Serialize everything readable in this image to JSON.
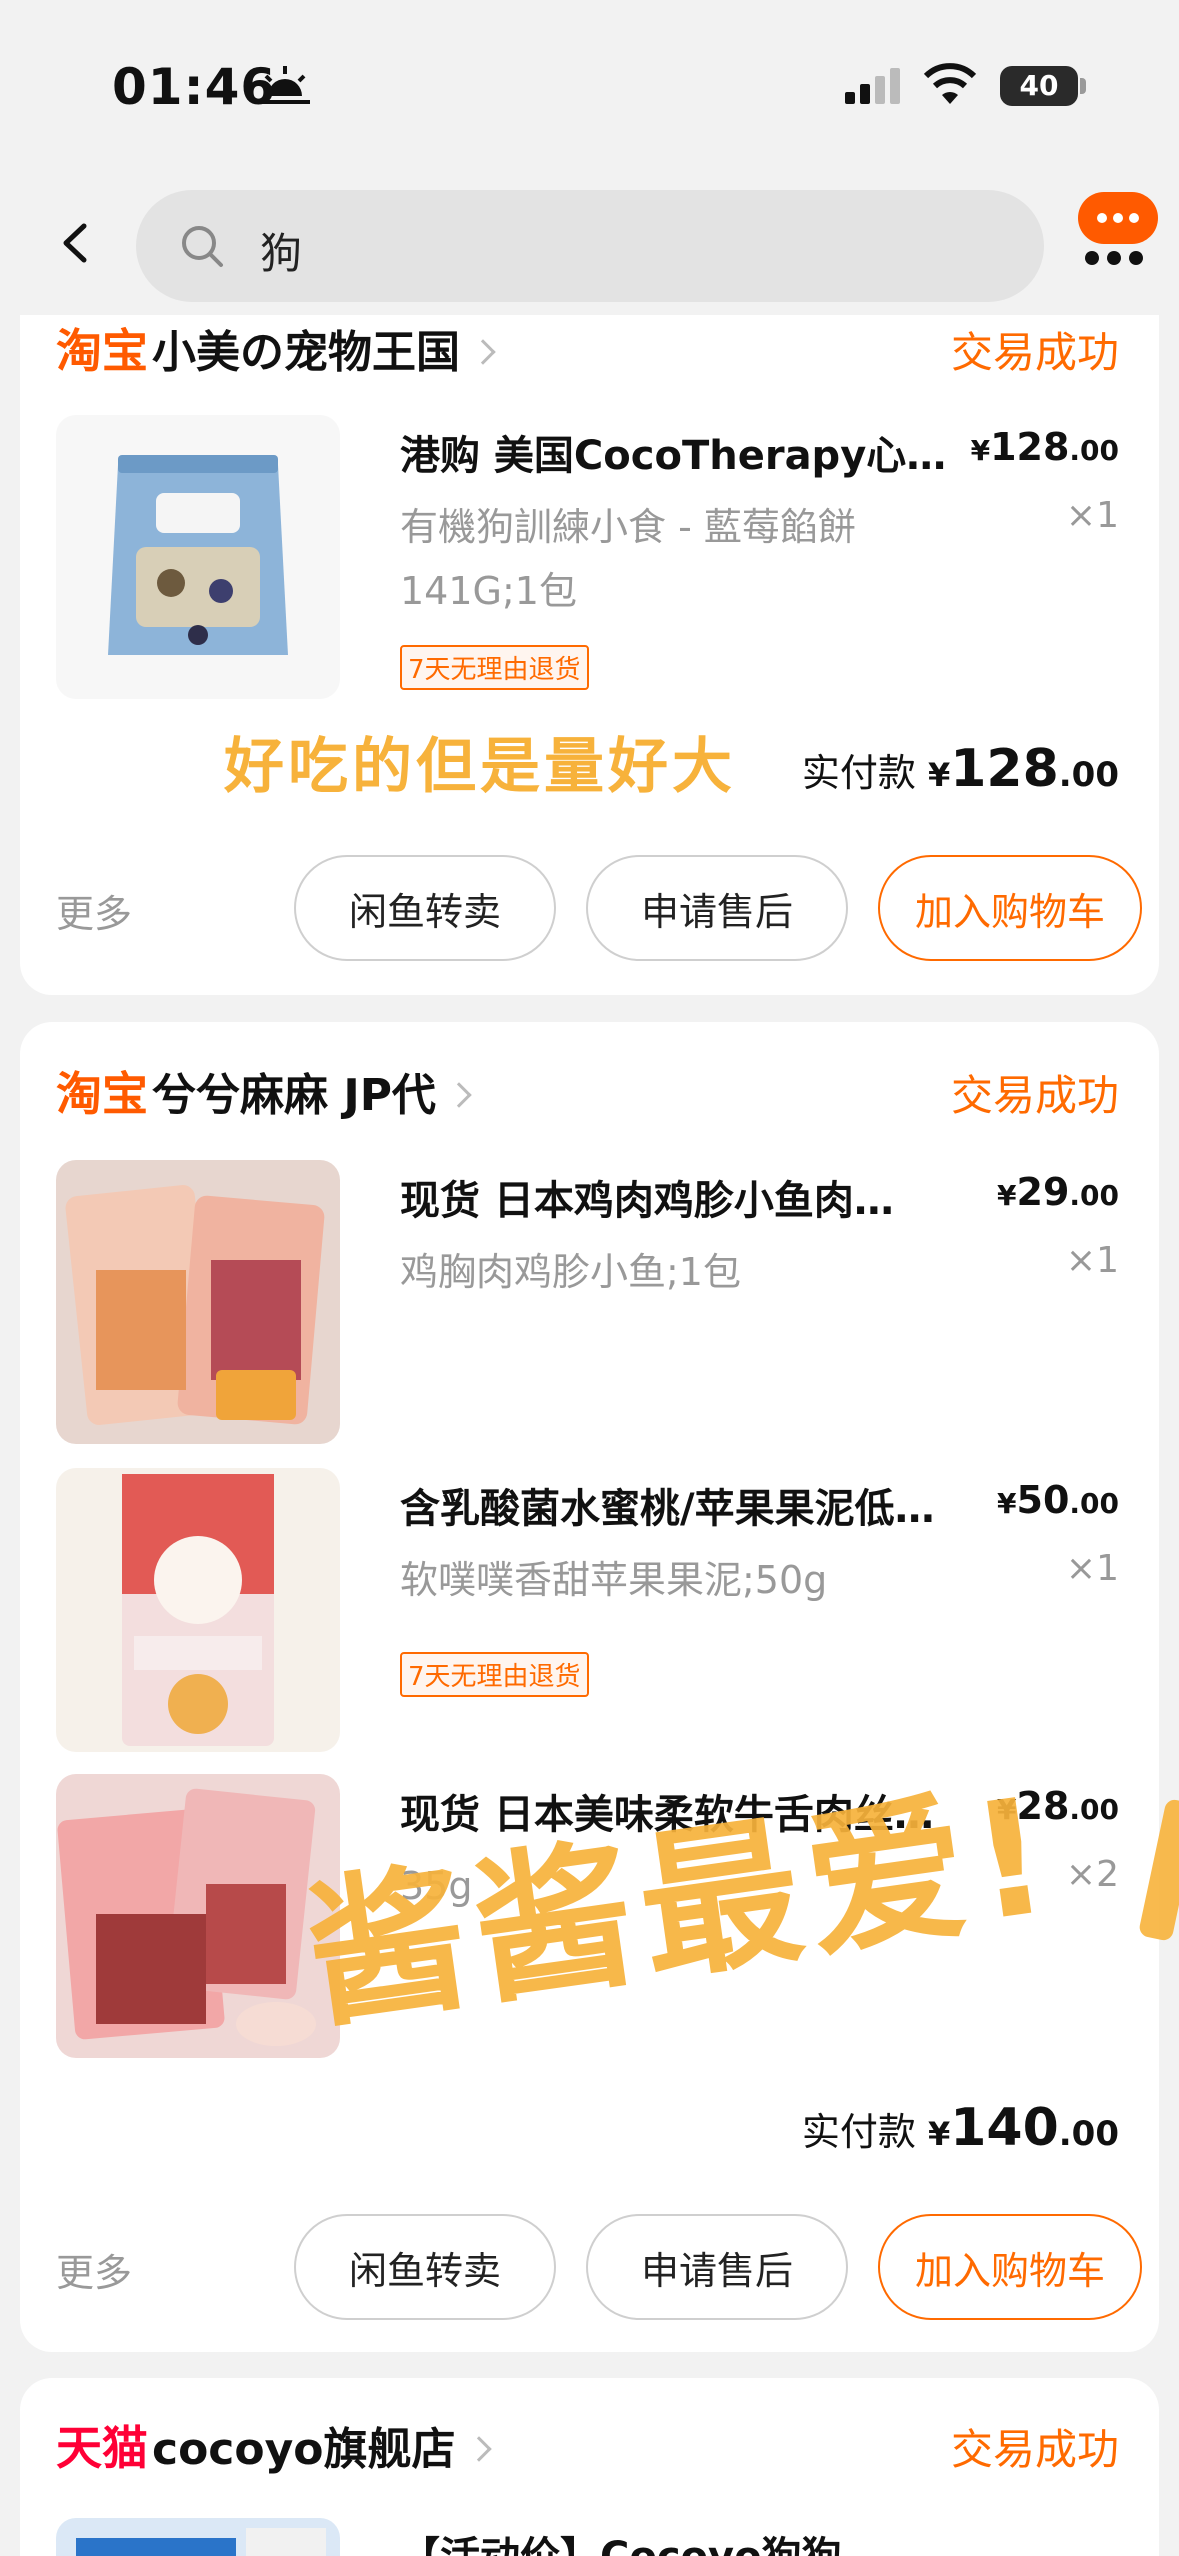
{
  "status_bar": {
    "time": "01:46",
    "battery": "40"
  },
  "search": {
    "query": "狗"
  },
  "orders": [
    {
      "platform": "淘宝",
      "shop": "小美の宠物王国",
      "status": "交易成功",
      "items": [
        {
          "title": "港购 美国CocoTherapy心…",
          "sku": "有機狗訓練小食 - 藍莓餡餅 141G;1包",
          "price_int": "128",
          "price_dec": ".00",
          "qty": "×1",
          "tag": "7天无理由退货"
        }
      ],
      "paid_label": "实付款",
      "paid_int": "128",
      "paid_dec": ".00",
      "more": "更多",
      "buttons": [
        "闲鱼转卖",
        "申请售后",
        "加入购物车"
      ]
    },
    {
      "platform": "淘宝",
      "shop": "兮兮麻麻 JP代",
      "status": "交易成功",
      "items": [
        {
          "title": "现货 日本鸡肉鸡胗小鱼肉…",
          "sku": "鸡胸肉鸡胗小鱼;1包",
          "price_int": "29",
          "price_dec": ".00",
          "qty": "×1"
        },
        {
          "title": "含乳酸菌水蜜桃/苹果果泥低…",
          "sku": "软噗噗香甜苹果果泥;50g",
          "price_int": "50",
          "price_dec": ".00",
          "qty": "×1",
          "tag": "7天无理由退货"
        },
        {
          "title": "现货 日本美味柔软牛舌肉丝…",
          "sku": "35g",
          "price_int": "28",
          "price_dec": ".00",
          "qty": "×2"
        }
      ],
      "paid_label": "实付款",
      "paid_int": "140",
      "paid_dec": ".00",
      "more": "更多",
      "buttons": [
        "闲鱼转卖",
        "申请售后",
        "加入购物车"
      ]
    },
    {
      "platform": "天猫",
      "shop": "cocoyo旗舰店",
      "status": "交易成功",
      "items": [
        {
          "title": "【活动价】Cocoyo狗狗尿垫"
        }
      ]
    }
  ],
  "currency": "¥",
  "overlays": {
    "note1": "好吃的但是量好大",
    "note2": "酱酱最爱!"
  },
  "colors": {
    "accent": "#ff6a00",
    "taobao": "#ff5a00",
    "tmall": "#ff0036",
    "overlay": "#f7b23b"
  }
}
